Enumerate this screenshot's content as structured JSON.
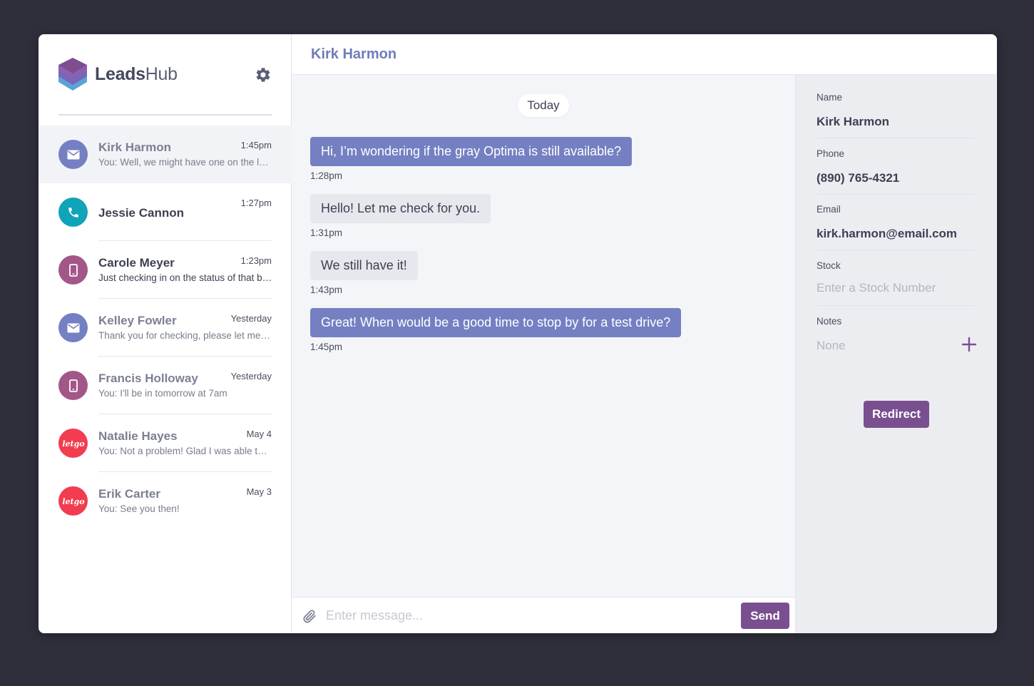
{
  "brand": {
    "name_bold": "Leads",
    "name_light": "Hub"
  },
  "colors": {
    "accent": "#7480c2",
    "primary_button": "#7a4f90",
    "background": "#2e2f3b",
    "email_avatar": "#7480c2",
    "phone_avatar": "#11a3b8",
    "mobile_avatar": "#a35788",
    "letgo_avatar": "#f23c50"
  },
  "conversations": [
    {
      "name": "Kirk Harmon",
      "time": "1:45pm",
      "preview": "You: Well, we might have one on the lot...",
      "icon": "email-icon",
      "active": true
    },
    {
      "name": "Jessie Cannon",
      "time": "1:27pm",
      "preview": "",
      "icon": "phone-icon",
      "active": false
    },
    {
      "name": "Carole Meyer",
      "time": "1:23pm",
      "preview": "Just checking in on the status of that bid...",
      "icon": "mobile-icon",
      "active": false
    },
    {
      "name": "Kelley Fowler",
      "time": "Yesterday",
      "preview": "Thank you for checking, please let me know...",
      "icon": "email-icon",
      "active": false
    },
    {
      "name": "Francis Holloway",
      "time": "Yesterday",
      "preview": "You: I'll be in tomorrow at 7am",
      "icon": "mobile-icon",
      "active": false
    },
    {
      "name": "Natalie Hayes",
      "time": "May 4",
      "preview": "You: Not a problem! Glad I was able to help",
      "icon": "letgo-icon",
      "active": false
    },
    {
      "name": "Erik Carter",
      "time": "May 3",
      "preview": "You: See you then!",
      "icon": "letgo-icon",
      "active": false
    }
  ],
  "letgo_label": "letgo",
  "chat": {
    "title": "Kirk Harmon",
    "day_label": "Today",
    "messages": [
      {
        "text": "Hi, I’m wondering if the gray Optima is still available?",
        "time": "1:28pm",
        "direction": "incoming-highlight"
      },
      {
        "text": "Hello! Let me check for you.",
        "time": "1:31pm",
        "direction": "outgoing"
      },
      {
        "text": "We still have it!",
        "time": "1:43pm",
        "direction": "outgoing"
      },
      {
        "text": "Great! When would be a good time to stop by for a test drive?",
        "time": "1:45pm",
        "direction": "incoming-highlight"
      }
    ],
    "input_placeholder": "Enter message...",
    "send_label": "Send"
  },
  "details": {
    "name_label": "Name",
    "name_value": "Kirk Harmon",
    "phone_label": "Phone",
    "phone_value": "(890) 765-4321",
    "email_label": "Email",
    "email_value": "kirk.harmon@email.com",
    "stock_label": "Stock",
    "stock_placeholder": "Enter a Stock Number",
    "notes_label": "Notes",
    "notes_value": "None",
    "redirect_label": "Redirect"
  }
}
